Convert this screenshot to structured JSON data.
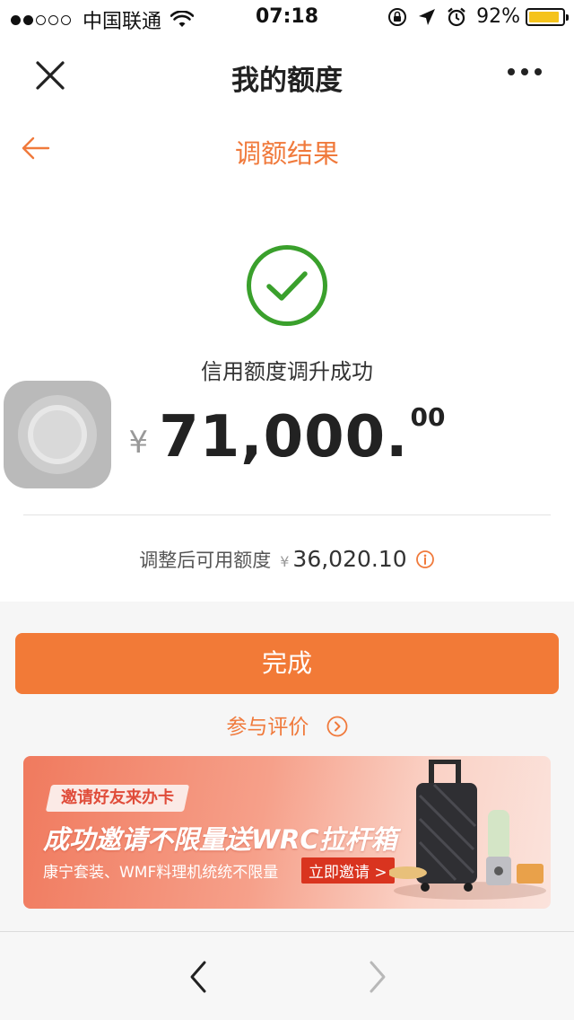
{
  "status_bar": {
    "carrier": "中国联通",
    "time": "07:18",
    "battery_percent": "92%",
    "battery_level": 0.92,
    "signal_bars_filled": 2,
    "signal_bars_total": 5
  },
  "nav": {
    "title": "我的额度",
    "close_icon": "close-icon",
    "more_icon": "more-dots-icon"
  },
  "result": {
    "subtitle": "调额结果",
    "status_text": "信用额度调升成功",
    "currency_symbol": "¥",
    "amount_integer": "71,000.",
    "amount_cents": "00",
    "available_label": "调整后可用额度",
    "available_currency": "¥",
    "available_value": "36,020.10"
  },
  "actions": {
    "done_label": "完成",
    "review_label": "参与评价"
  },
  "banner": {
    "tag": "邀请好友来办卡",
    "headline": "成功邀请不限量送WRC拉杆箱",
    "subtext": "康宁套装、WMF料理机统统不限量",
    "cta": "立即邀请 >"
  },
  "colors": {
    "accent": "#f27a37",
    "success": "#3aa02c",
    "battery": "#f5c31c"
  }
}
